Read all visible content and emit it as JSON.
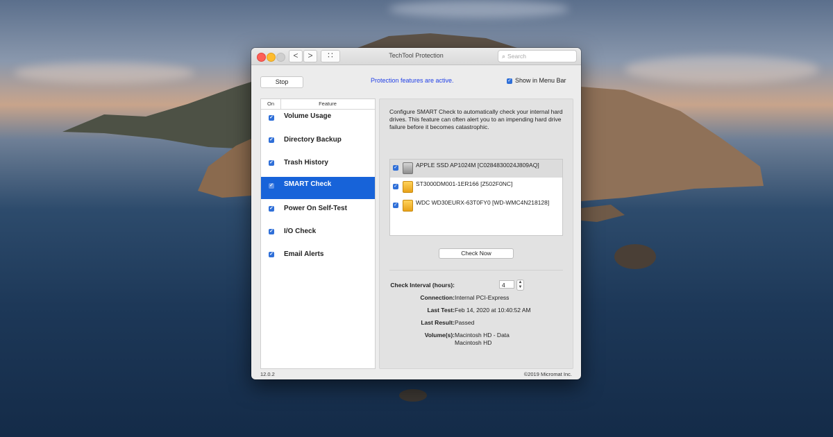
{
  "window": {
    "title": "TechTool Protection",
    "search_placeholder": "Search",
    "back_label": "<",
    "forward_label": ">",
    "grid_label": "∷"
  },
  "toolbar": {
    "stop_label": "Stop",
    "status": "Protection features are active.",
    "show_menu_bar_label": "Show in Menu Bar",
    "show_menu_bar_checked": true
  },
  "feature_list": {
    "col_on": "On",
    "col_feature": "Feature",
    "items": [
      {
        "label": "Volume Usage",
        "checked": true
      },
      {
        "label": "Directory Backup",
        "checked": true
      },
      {
        "label": "Trash History",
        "checked": true
      },
      {
        "label": "SMART Check",
        "checked": true,
        "selected": true
      },
      {
        "label": "Power On Self-Test",
        "checked": true
      },
      {
        "label": "I/O Check",
        "checked": true
      },
      {
        "label": "Email Alerts",
        "checked": true
      }
    ]
  },
  "detail": {
    "description": "Configure SMART Check to automatically check your internal hard drives. This feature can often alert you to an impending hard drive failure before it becomes catastrophic.",
    "drives": [
      {
        "label": "APPLE SSD AP1024M [C0284830024J809AQ]",
        "checked": true,
        "icon": "ssd-icon",
        "selected": true
      },
      {
        "label": "ST3000DM001-1ER166 [Z502F0NC]",
        "checked": true,
        "icon": "hard-drive-icon"
      },
      {
        "label": "WDC WD30EURX-63T0FY0 [WD-WMC4N218128]",
        "checked": true,
        "icon": "hard-drive-icon"
      }
    ],
    "check_now_label": "Check Now",
    "interval_label": "Check Interval (hours):",
    "interval_value": "4",
    "connection_label": "Connection:",
    "connection_value": "Internal PCI-Express",
    "last_test_label": "Last Test:",
    "last_test_value": "Feb 14, 2020 at 10:40:52 AM",
    "last_result_label": "Last Result:",
    "last_result_value": "Passed",
    "volumes_label": "Volume(s):",
    "volumes_value_1": "Macintosh HD - Data",
    "volumes_value_2": "Macintosh HD"
  },
  "footer": {
    "version": "12.0.2",
    "copyright": "©2019 Micromat Inc."
  },
  "colors": {
    "accent": "#1763d9",
    "status_text": "#1f3ee6"
  }
}
